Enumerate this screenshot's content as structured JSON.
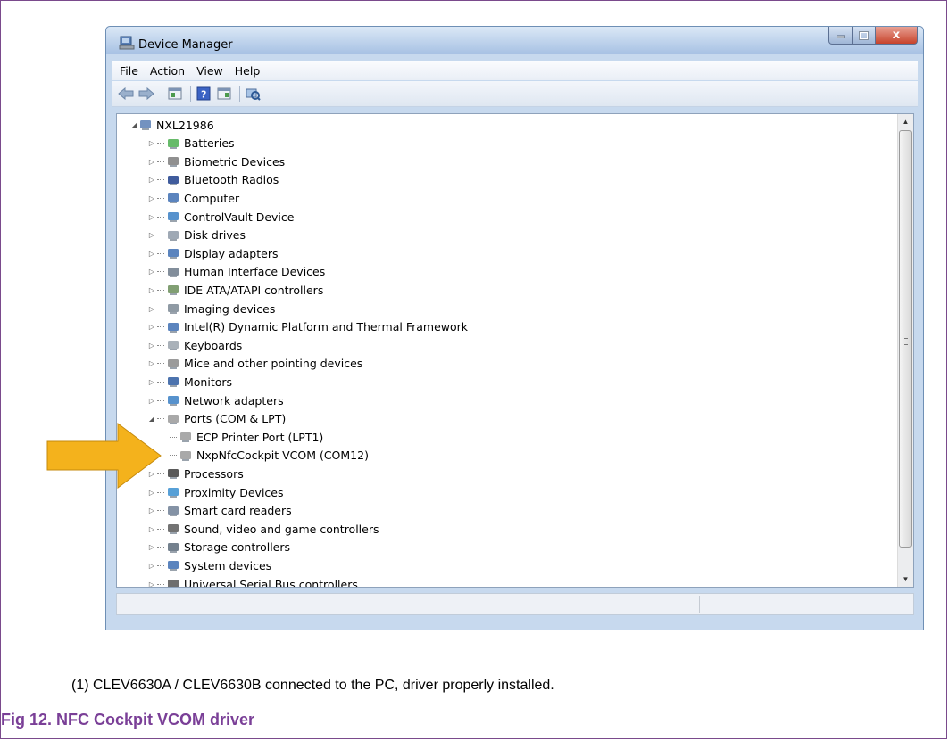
{
  "window": {
    "title": "Device Manager",
    "close_glyph": "x"
  },
  "menu": {
    "items": [
      "File",
      "Action",
      "View",
      "Help"
    ]
  },
  "toolbar": {
    "buttons": [
      "back-icon",
      "forward-icon",
      "properties-icon",
      "help-icon",
      "show-hide-icon",
      "scan-hardware-icon"
    ]
  },
  "tree": {
    "root": "NXL21986",
    "categories": [
      {
        "label": "Batteries",
        "icon": "battery-icon",
        "expanded": false
      },
      {
        "label": "Biometric Devices",
        "icon": "fingerprint-icon",
        "expanded": false
      },
      {
        "label": "Bluetooth Radios",
        "icon": "bluetooth-icon",
        "expanded": false
      },
      {
        "label": "Computer",
        "icon": "computer-icon",
        "expanded": false
      },
      {
        "label": "ControlVault Device",
        "icon": "network-icon",
        "expanded": false
      },
      {
        "label": "Disk drives",
        "icon": "disk-icon",
        "expanded": false
      },
      {
        "label": "Display adapters",
        "icon": "display-icon",
        "expanded": false
      },
      {
        "label": "Human Interface Devices",
        "icon": "hid-icon",
        "expanded": false
      },
      {
        "label": "IDE ATA/ATAPI controllers",
        "icon": "ide-icon",
        "expanded": false
      },
      {
        "label": "Imaging devices",
        "icon": "imaging-icon",
        "expanded": false
      },
      {
        "label": "Intel(R) Dynamic Platform and Thermal Framework",
        "icon": "computer-icon",
        "expanded": false
      },
      {
        "label": "Keyboards",
        "icon": "keyboard-icon",
        "expanded": false
      },
      {
        "label": "Mice and other pointing devices",
        "icon": "mouse-icon",
        "expanded": false
      },
      {
        "label": "Monitors",
        "icon": "monitor-icon",
        "expanded": false
      },
      {
        "label": "Network adapters",
        "icon": "network-icon",
        "expanded": false
      },
      {
        "label": "Ports (COM & LPT)",
        "icon": "port-icon",
        "expanded": true,
        "children": [
          "ECP Printer Port (LPT1)",
          "NxpNfcCockpit VCOM (COM12)"
        ]
      },
      {
        "label": "Processors",
        "icon": "processor-icon",
        "expanded": false
      },
      {
        "label": "Proximity Devices",
        "icon": "proximity-icon",
        "expanded": false
      },
      {
        "label": "Smart card readers",
        "icon": "smartcard-icon",
        "expanded": false
      },
      {
        "label": "Sound, video and game controllers",
        "icon": "speaker-icon",
        "expanded": false
      },
      {
        "label": "Storage controllers",
        "icon": "storage-icon",
        "expanded": false
      },
      {
        "label": "System devices",
        "icon": "computer-icon",
        "expanded": false
      },
      {
        "label": "Universal Serial Bus controllers",
        "icon": "usb-icon",
        "expanded": false
      }
    ]
  },
  "annotation": {
    "arrow_color": "#f4b21c"
  },
  "footnote": "(1)   CLEV6630A / CLEV6630B connected to the PC, driver properly installed.",
  "caption": "Fig 12. NFC Cockpit VCOM driver"
}
